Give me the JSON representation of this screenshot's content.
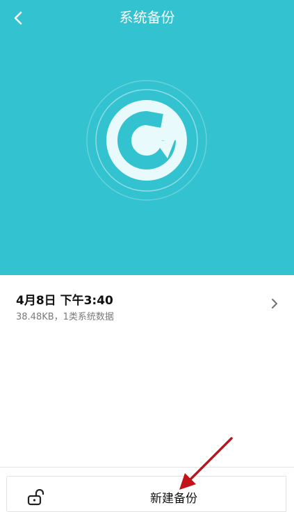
{
  "header": {
    "title": "系统备份",
    "back_icon": "back-arrow-icon"
  },
  "hero": {
    "background_color": "#33c2cf",
    "icon": "backup-restore-icon"
  },
  "backup_list": [
    {
      "date": "4月8日 下午3:40",
      "details": "38.48KB，1类系统数据",
      "chevron_icon": "chevron-right-icon"
    }
  ],
  "bottom_bar": {
    "lock_icon": "unlock-icon",
    "new_backup_label": "新建备份"
  },
  "annotation": {
    "arrow_color": "#c0141a"
  }
}
